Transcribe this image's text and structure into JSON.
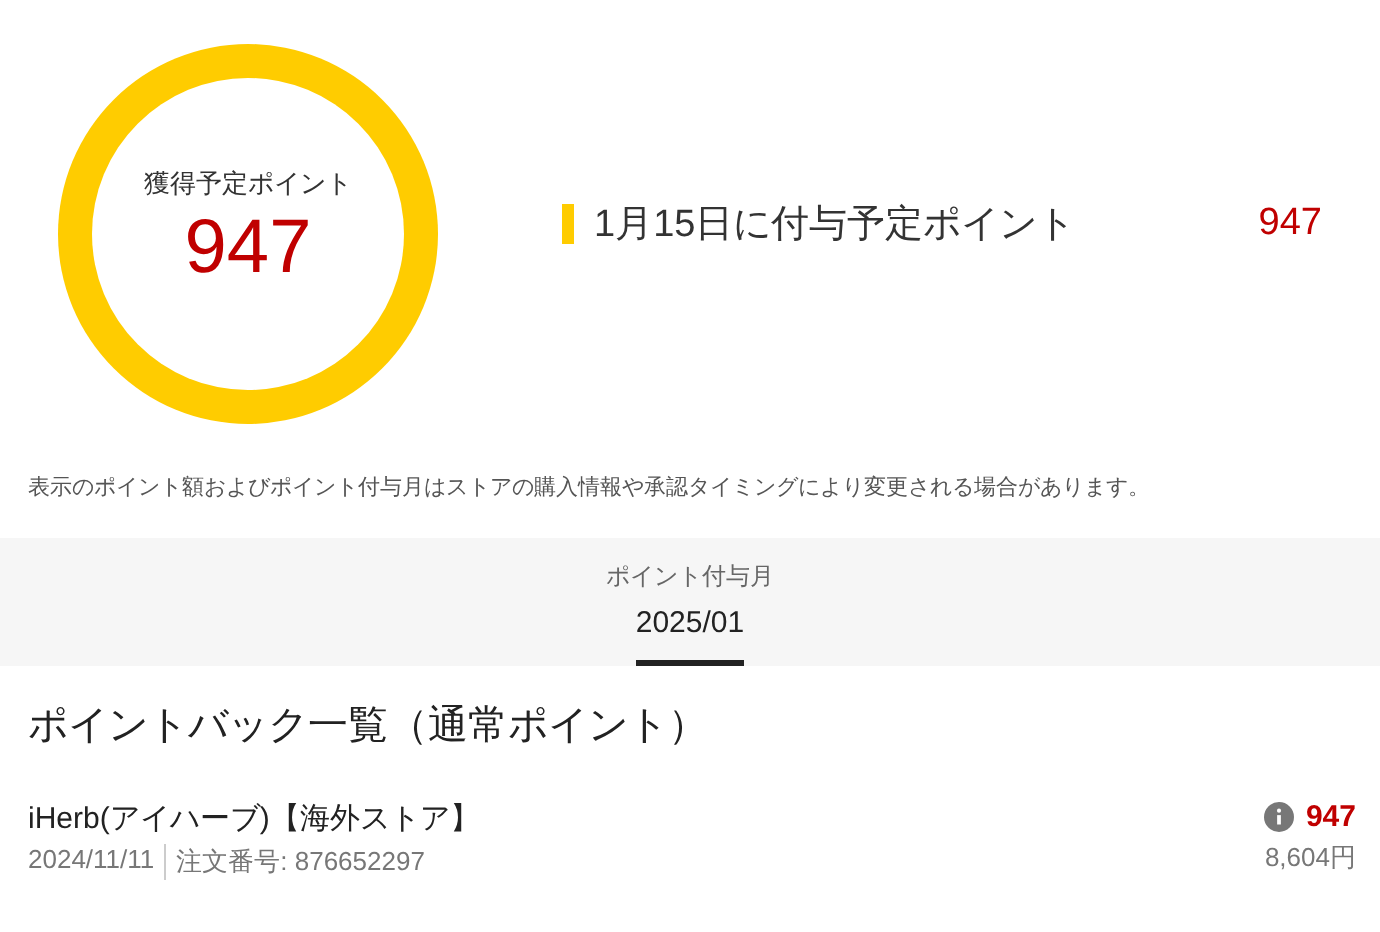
{
  "summary": {
    "ring_label": "獲得予定ポイント",
    "ring_value": "947",
    "scheduled_label": "1月15日に付与予定ポイント",
    "scheduled_value": "947"
  },
  "notice": "表示のポイント額およびポイント付与月はストアの購入情報や承認タイミングにより変更される場合があります。",
  "month_picker": {
    "label": "ポイント付与月",
    "months": [
      {
        "label": "2025/01",
        "selected": true
      }
    ]
  },
  "list": {
    "title": "ポイントバック一覧（通常ポイント）",
    "items": [
      {
        "store": "iHerb(アイハーブ)【海外ストア】",
        "date": "2024/11/11",
        "order": "注文番号: 876652297",
        "points": "947",
        "amount": "8,604円"
      }
    ]
  }
}
